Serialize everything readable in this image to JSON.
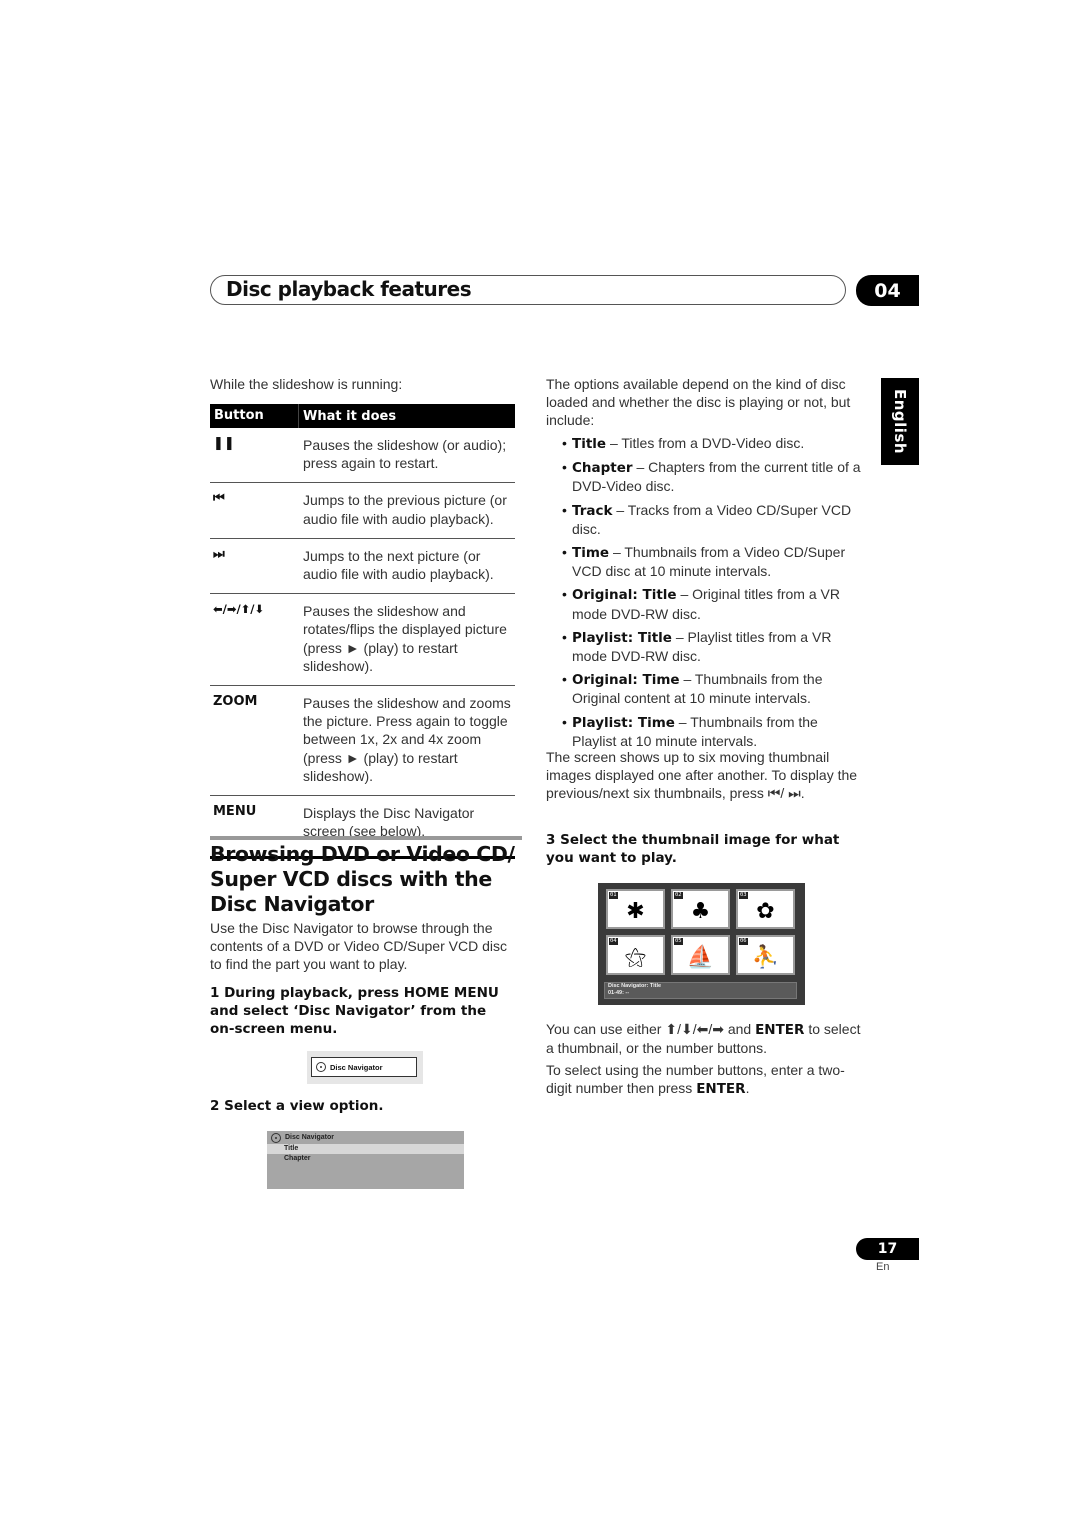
{
  "header": {
    "title": "Disc playback features",
    "chapter_number": "04"
  },
  "language_tab": "English",
  "left_column": {
    "intro": "While the slideshow is running:",
    "table": {
      "columns": [
        "Button",
        "What it does"
      ],
      "rows": [
        {
          "button_icon": "pause-icon",
          "button": "❚❚",
          "description": "Pauses the slideshow (or audio); press again to restart."
        },
        {
          "button_icon": "previous-track-icon",
          "button": "⏮",
          "description": "Jumps to the previous picture (or audio file with audio playback)."
        },
        {
          "button_icon": "next-track-icon",
          "button": "⏭",
          "description": "Jumps to the next picture (or audio file with audio playback)."
        },
        {
          "button_icon": "arrow-keys-icon",
          "button": "⬅/➡/⬆/⬇",
          "description": "Pauses the slideshow and rotates/flips the displayed picture (press ► (play) to restart slideshow)."
        },
        {
          "button_icon": "",
          "button": "ZOOM",
          "description": "Pauses the slideshow and zooms the picture. Press again to toggle between 1x, 2x and 4x zoom (press ► (play) to restart slideshow)."
        },
        {
          "button_icon": "",
          "button": "MENU",
          "description": "Displays the Disc Navigator screen (see below)."
        }
      ]
    },
    "section_heading": "Browsing DVD or Video CD/ Super VCD discs with the Disc Navigator",
    "section_intro": "Use the Disc Navigator to browse through the contents of a DVD or Video CD/Super VCD disc to find the part you want to play.",
    "step1": "1   During playback, press HOME MENU and select ‘Disc Navigator’ from the on-screen menu.",
    "menu_item_label": "Disc Navigator",
    "step2": "2   Select a view option.",
    "view_menu": {
      "title": "Disc Navigator",
      "options": [
        "Title",
        "Chapter"
      ],
      "selected": "Title"
    }
  },
  "right_column": {
    "intro": "The options available depend on the kind of disc loaded and whether the disc is playing or not, but include:",
    "options": [
      {
        "term": "Title",
        "desc": " – Titles from a DVD-Video disc."
      },
      {
        "term": "Chapter",
        "desc": " – Chapters from the current title of a DVD-Video disc."
      },
      {
        "term": "Track",
        "desc": " – Tracks from a Video CD/Super VCD disc."
      },
      {
        "term": "Time",
        "desc": " – Thumbnails from a Video CD/Super VCD disc at 10 minute intervals."
      },
      {
        "term": "Original: Title",
        "desc": " – Original titles from a VR mode DVD-RW disc."
      },
      {
        "term": "Playlist: Title",
        "desc": " – Playlist titles from a VR mode DVD-RW disc."
      },
      {
        "term": "Original: Time",
        "desc": " – Thumbnails from the Original content at 10 minute intervals."
      },
      {
        "term": "Playlist: Time",
        "desc": " – Thumbnails from the Playlist at 10 minute intervals."
      }
    ],
    "thumbnail_note": "The screen shows up to six moving thumbnail images displayed one after another. To display the previous/next six thumbnails, press ⏮/ ⏭.",
    "step3": "3   Select the thumbnail image for what you want to play.",
    "thumbnails": [
      {
        "num": "01",
        "icon": "leaf-icon",
        "glyph": "✱"
      },
      {
        "num": "02",
        "icon": "tree-icon",
        "glyph": "♣"
      },
      {
        "num": "03",
        "icon": "flower-icon",
        "glyph": "✿"
      },
      {
        "num": "04",
        "icon": "bird-icon",
        "glyph": "⚝"
      },
      {
        "num": "05",
        "icon": "windsurfer-icon",
        "glyph": "⛵"
      },
      {
        "num": "06",
        "icon": "skater-icon",
        "glyph": "⛹"
      }
    ],
    "thumbnail_status_line1": "Disc Navigator: Title",
    "thumbnail_status_line2": "01-49: --",
    "select_note_prefix": "You can use either ⬆/⬇/⬅/➡ and ",
    "select_note_enter": "ENTER",
    "select_note_suffix": " to select a thumbnail, or the number buttons.",
    "number_note_prefix": "To select using the number buttons, enter a two-digit number then press ",
    "number_note_enter": "ENTER",
    "number_note_suffix": "."
  },
  "footer": {
    "page_number": "17",
    "language": "En"
  }
}
